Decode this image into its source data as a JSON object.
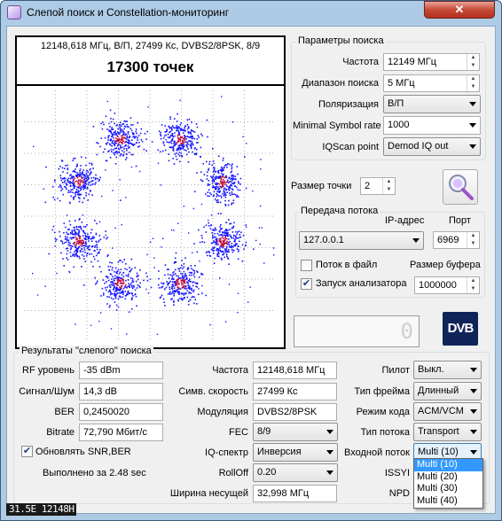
{
  "window": {
    "title": "Слепой поиск и Constellation-мониторинг",
    "close_glyph": "✕"
  },
  "plot": {
    "subtitle": "12148,618 МГц, В/П, 27499 Кс, DVBS2/8PSK, 8/9",
    "title": "17300 точек",
    "clusters": 8,
    "colors": {
      "point": "#1515ff",
      "core": "#c01040"
    }
  },
  "search": {
    "group_title": "Параметры поиска",
    "freq_label": "Частота",
    "freq_value": "12149 МГц",
    "range_label": "Диапазон поиска",
    "range_value": "5 МГц",
    "pol_label": "Поляризация",
    "pol_value": "В/П",
    "min_sr_label": "Minimal Symbol rate",
    "min_sr_value": "1000",
    "iqscan_label": "IQScan point",
    "iqscan_value": "Demod IQ out"
  },
  "point_size": {
    "label": "Размер точки",
    "value": "2"
  },
  "stream": {
    "group_title": "Передача потока",
    "ip_label": "IP-адрес",
    "ip_value": "127.0.0.1",
    "port_label": "Порт",
    "port_value": "6969",
    "to_file_label": "Поток в файл",
    "to_file_checked": false,
    "buffer_label": "Размер буфера",
    "buffer_value": "1000000",
    "analyzer_label": "Запуск анализатора",
    "analyzer_checked": true
  },
  "lcd": {
    "value": "0"
  },
  "dvb_logo": "DVB",
  "results": {
    "group_title": "Результаты \"слепого\" поиска",
    "rf_label": "RF уровень",
    "rf_value": "-35 dBm",
    "snr_label": "Сигнал/Шум",
    "snr_value": "14,3 dB",
    "ber_label": "BER",
    "ber_value": "0,2450020",
    "bitrate_label": "Bitrate",
    "bitrate_value": "72,790 Мбит/с",
    "update_label": "Обновлять SNR,BER",
    "update_checked": true,
    "done_label": "Выполнено за 2.48 sec",
    "freq_label": "Частота",
    "freq_value": "12148,618 МГц",
    "sr_label": "Симв. скорость",
    "sr_value": "27499 Кс",
    "mod_label": "Модуляция",
    "mod_value": "DVBS2/8PSK",
    "fec_label": "FEC",
    "fec_value": "8/9",
    "iq_label": "IQ-спектр",
    "iq_value": "Инверсия",
    "rolloff_label": "RollOff",
    "rolloff_value": "0.20",
    "bw_label": "Ширина несущей",
    "bw_value": "32,998 МГц",
    "pilot_label": "Пилот",
    "pilot_value": "Выкл.",
    "frame_label": "Тип фрейма",
    "frame_value": "Длинный",
    "code_label": "Режим кода",
    "code_value": "ACM/VCM",
    "stream_type_label": "Тип потока",
    "stream_type_value": "Transport",
    "input_stream_label": "Входной поток",
    "input_stream_value": "Multi (10)",
    "issyi_label": "ISSYI",
    "npd_label": "NPD",
    "input_stream_options": [
      "Multi (10)",
      "Multi (20)",
      "Multi (30)",
      "Multi (40)"
    ]
  },
  "status": {
    "text": "31.5E 12148H"
  }
}
